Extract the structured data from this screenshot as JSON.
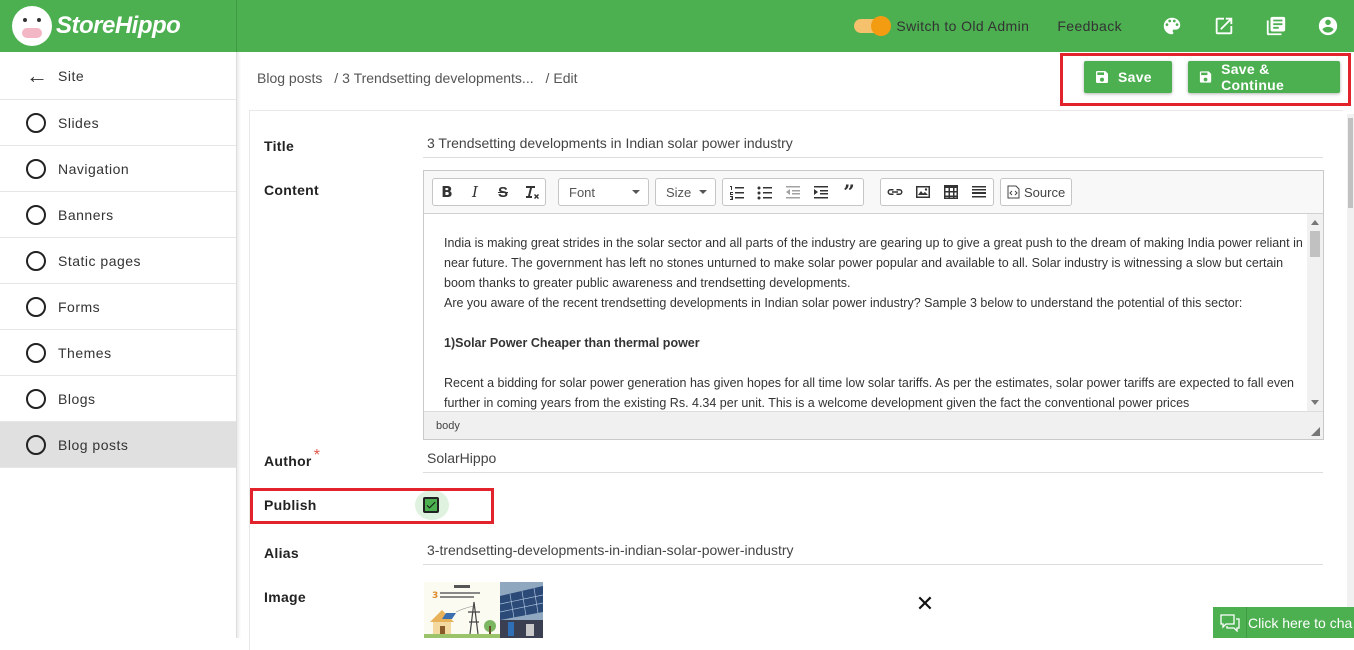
{
  "app": {
    "logo_text": "StoreHippo"
  },
  "topbar": {
    "switch_label": "Switch to Old Admin",
    "feedback_label": "Feedback"
  },
  "sidebar": {
    "back_label": "Site",
    "items": [
      {
        "label": "Slides"
      },
      {
        "label": "Navigation"
      },
      {
        "label": "Banners"
      },
      {
        "label": "Static pages"
      },
      {
        "label": "Forms"
      },
      {
        "label": "Themes"
      },
      {
        "label": "Blogs"
      },
      {
        "label": "Blog posts"
      }
    ]
  },
  "breadcrumb": {
    "root": "Blog posts",
    "item": "3 Trendsetting developments...",
    "current": "Edit"
  },
  "actions": {
    "save_label": "Save",
    "save_continue_label": "Save & Continue"
  },
  "form": {
    "title_label": "Title",
    "title_value": "3 Trendsetting developments in Indian solar power industry",
    "content_label": "Content",
    "author_label": "Author",
    "author_required": "*",
    "author_value": "SolarHippo",
    "publish_label": "Publish",
    "publish_checked": true,
    "alias_label": "Alias",
    "alias_value": "3-trendsetting-developments-in-indian-solar-power-industry",
    "image_label": "Image"
  },
  "editor": {
    "font_combo": "Font",
    "size_combo": "Size",
    "source_label": "Source",
    "status_path": "body",
    "paragraphs": {
      "p1": "India is making great strides in the solar sector and all parts of the industry are gearing up to give a great push to the dream of making India power reliant in near future. The government has left no stones unturned to make solar power popular and available to all. Solar industry is witnessing a slow but certain boom thanks to greater public awareness and trendsetting developments.",
      "p2": "Are you aware of the recent trendsetting developments in Indian solar power industry? Sample 3 below to understand the potential of this sector:",
      "h1": "1)Solar Power Cheaper than thermal power",
      "p3": "Recent a bidding for solar power generation has given hopes for all time low solar tariffs. As per the estimates, solar power tariffs are expected to fall even further in coming years from the existing Rs. 4.34 per unit. This is a welcome development given the fact the conventional power prices"
    }
  },
  "chat_widget": {
    "label": "Click here to cha"
  }
}
